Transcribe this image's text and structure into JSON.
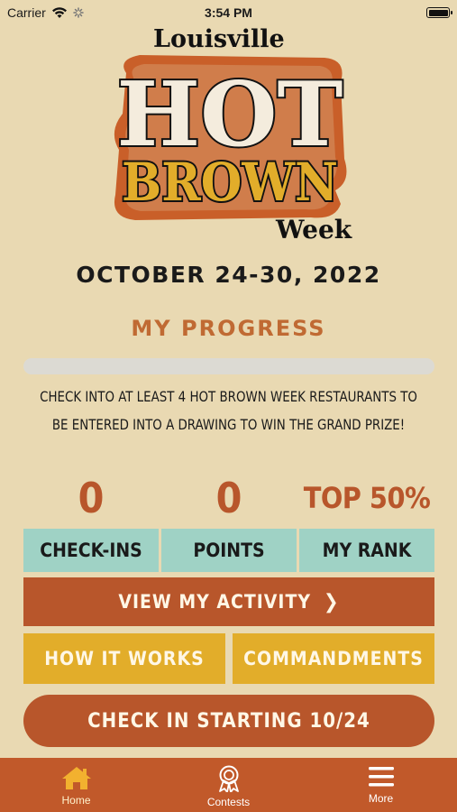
{
  "status_bar": {
    "carrier": "Carrier",
    "time": "3:54 PM",
    "battery_level": 1.0
  },
  "logo": {
    "line1": "Louisville",
    "line2": "HOT",
    "line3": "BROWN",
    "line4": "Week"
  },
  "event_dates": "OCTOBER 24-30, 2022",
  "progress": {
    "title": "MY PROGRESS",
    "fraction": 0,
    "instructions_line1": "CHECK INTO AT LEAST 4 HOT BROWN WEEK RESTAURANTS TO",
    "instructions_line2": "BE ENTERED INTO A DRAWING TO WIN THE GRAND PRIZE!"
  },
  "stats": [
    {
      "value": "0",
      "label": "CHECK-INS"
    },
    {
      "value": "0",
      "label": "POINTS"
    },
    {
      "value": "TOP 50%",
      "label": "MY RANK"
    }
  ],
  "buttons": {
    "view_activity": "VIEW MY ACTIVITY",
    "how_it_works": "HOW IT WORKS",
    "commandments": "COMMANDMENTS",
    "check_in": "CHECK IN STARTING 10/24"
  },
  "tabbar": {
    "items": [
      {
        "label": "Home",
        "icon": "home-icon"
      },
      {
        "label": "Contests",
        "icon": "award-ribbon-icon"
      },
      {
        "label": "More",
        "icon": "menu-icon"
      }
    ]
  },
  "colors": {
    "background": "#e9d9b2",
    "accent_orange": "#b8562b",
    "accent_yellow": "#e2ad2a",
    "accent_teal": "#9fd2c5",
    "progress_title": "#c06a33"
  }
}
